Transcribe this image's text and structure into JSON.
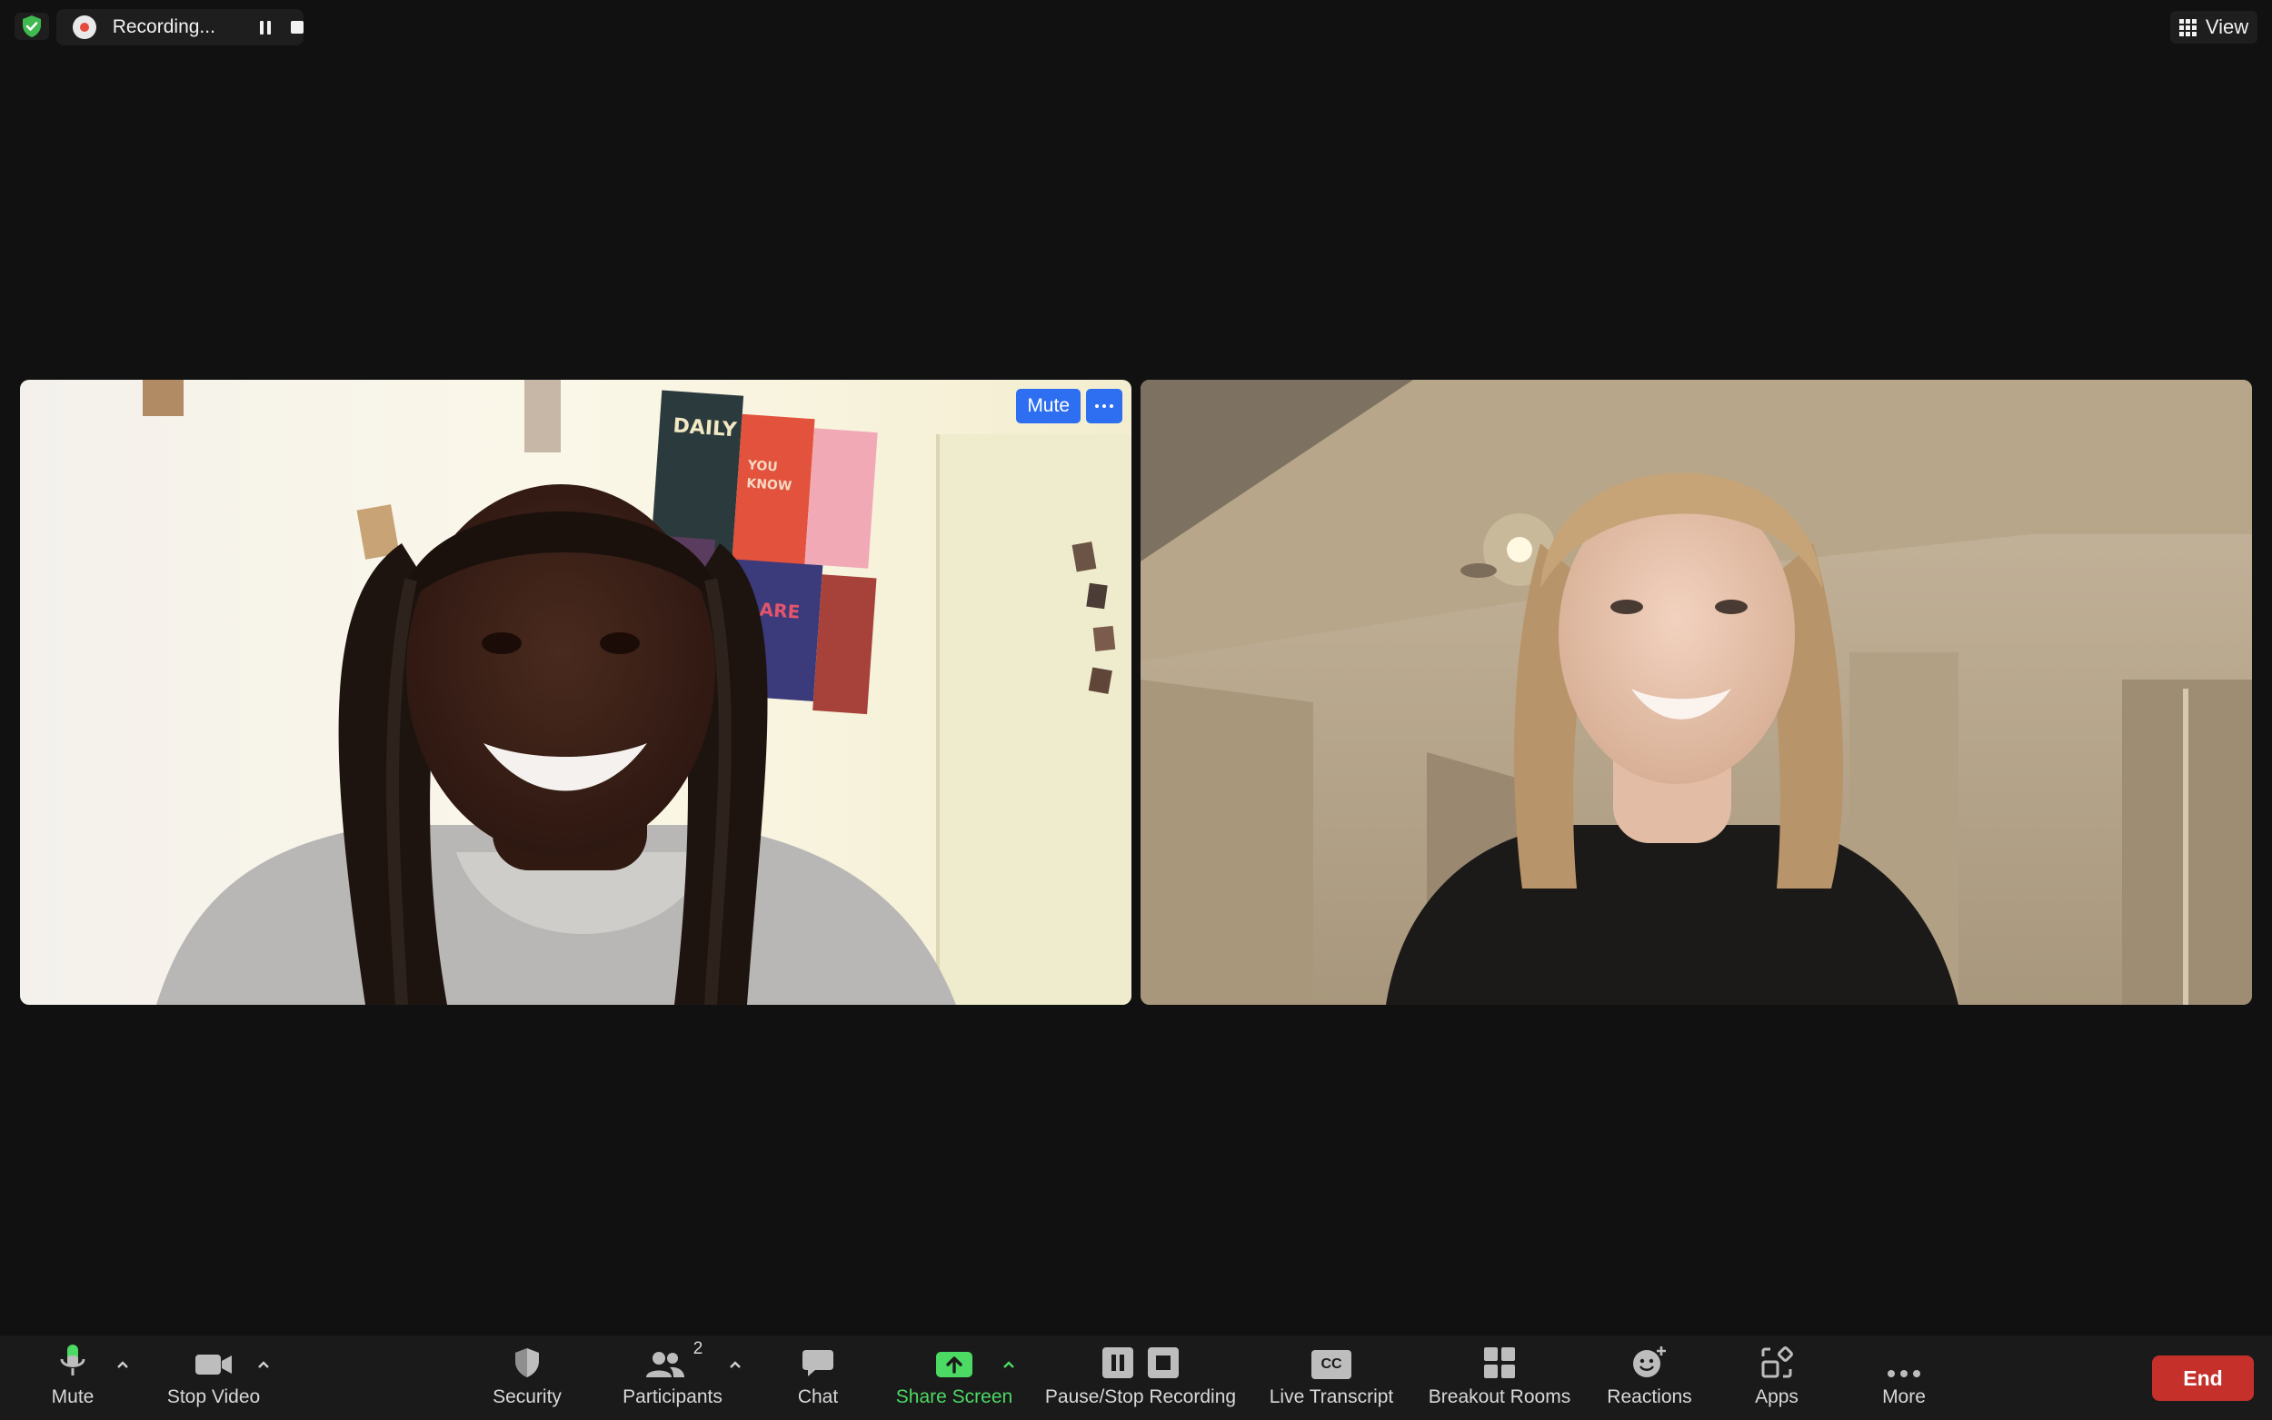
{
  "top_bar": {
    "recording_label": "Recording...",
    "view_label": "View"
  },
  "tiles": [
    {
      "mute_label": "Mute"
    },
    {}
  ],
  "toolbar": {
    "mute_label": "Mute",
    "stop_video_label": "Stop Video",
    "security_label": "Security",
    "participants_label": "Participants",
    "participants_count": "2",
    "chat_label": "Chat",
    "share_screen_label": "Share Screen",
    "pause_stop_recording_label": "Pause/Stop Recording",
    "live_transcript_label": "Live Transcript",
    "live_transcript_icon_text": "CC",
    "breakout_rooms_label": "Breakout Rooms",
    "reactions_label": "Reactions",
    "apps_label": "Apps",
    "more_label": "More",
    "end_label": "End"
  },
  "colors": {
    "background": "#111111",
    "toolbar": "#1a1a1a",
    "accent_blue": "#2d6ff0",
    "share_green": "#4cd964",
    "end_red": "#c5302b",
    "security_shield": "#3fb950"
  }
}
